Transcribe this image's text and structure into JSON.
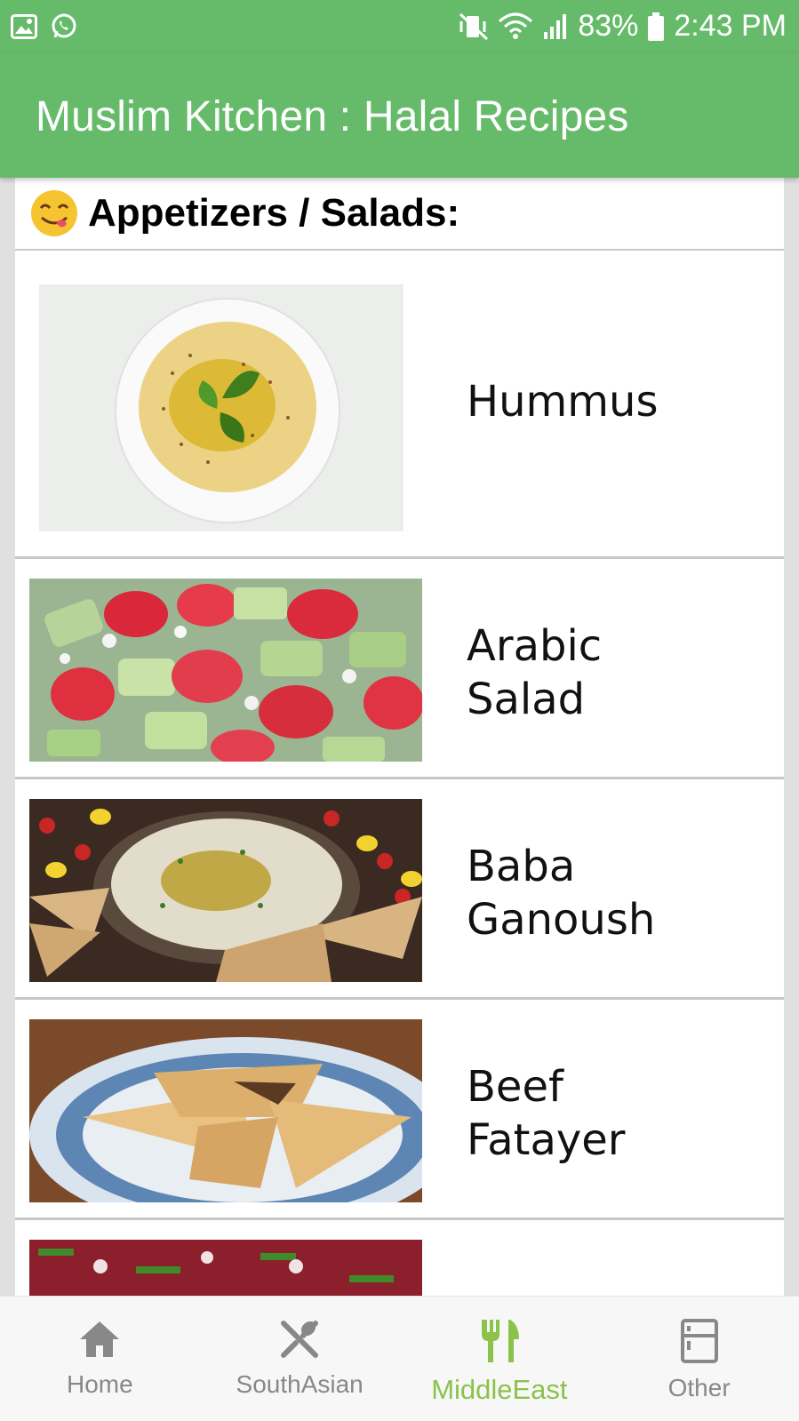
{
  "status_bar": {
    "battery": "83%",
    "time": "2:43 PM",
    "left_icons": [
      "image-icon",
      "whatsapp-icon"
    ],
    "right_icons": [
      "mute-vibrate-icon",
      "wifi-icon",
      "signal-icon",
      "battery-icon"
    ]
  },
  "app_bar": {
    "title": "Muslim Kitchen : Halal Recipes"
  },
  "section": {
    "title": "Appetizers / Salads:",
    "emoji": "yum-face-emoji"
  },
  "recipes": [
    {
      "label": "Hummus"
    },
    {
      "label": "Arabic\nSalad"
    },
    {
      "label": "Baba\nGanoush"
    },
    {
      "label": "Beef\nFatayer"
    }
  ],
  "bottom_nav": {
    "items": [
      {
        "label": "Home",
        "icon": "home-icon"
      },
      {
        "label": "SouthAsian",
        "icon": "utensils-cross-icon"
      },
      {
        "label": "MiddleEast",
        "icon": "fork-knife-icon",
        "active": true
      },
      {
        "label": "Other",
        "icon": "fridge-icon"
      }
    ]
  },
  "colors": {
    "primary": "#66bb6a",
    "active_tab": "#8bc34a",
    "inactive_tab": "#888888"
  }
}
